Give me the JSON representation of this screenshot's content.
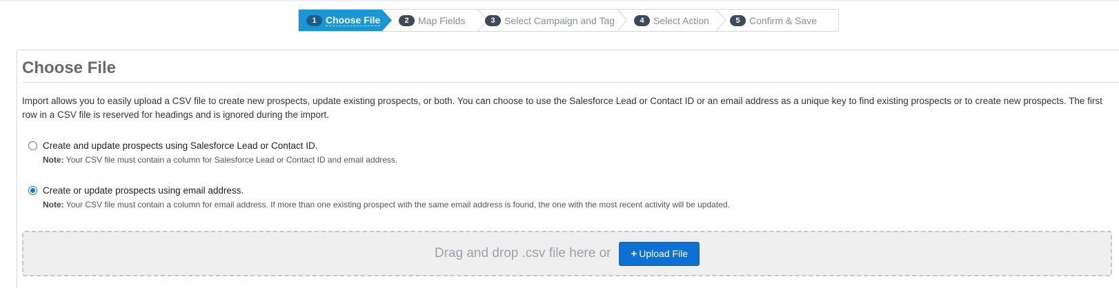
{
  "wizard": {
    "steps": [
      {
        "num": "1",
        "label": "Choose File"
      },
      {
        "num": "2",
        "label": "Map Fields"
      },
      {
        "num": "3",
        "label": "Select Campaign and Tag"
      },
      {
        "num": "4",
        "label": "Select Action"
      },
      {
        "num": "5",
        "label": "Confirm & Save"
      }
    ],
    "active_step": "1",
    "active_color": "#1b96d4"
  },
  "panel": {
    "title": "Choose File",
    "description": "Import allows you to easily upload a CSV file to create new prospects, update existing prospects, or both. You can choose to use the Salesforce Lead or Contact ID or an email address as a unique key to find existing prospects or to create new prospects. The first row in a CSV file is reserved for headings and is ignored during the import."
  },
  "options": [
    {
      "label": "Create and update prospects using Salesforce Lead or Contact ID.",
      "note_prefix": "Note:",
      "note": "Your CSV file must contain a column for Salesforce Lead or Contact ID and email address.",
      "checked": false
    },
    {
      "label": "Create or update prospects using email address.",
      "note_prefix": "Note:",
      "note": "Your CSV file must contain a column for email address. If more than one existing prospect with the same email address is found, the one with the most recent activity will be updated.",
      "checked": true
    }
  ],
  "dropzone": {
    "text": "Drag and drop .csv file here or",
    "button_label": "Upload File",
    "button_icon": "plus-icon",
    "button_color": "#0d70d3"
  }
}
